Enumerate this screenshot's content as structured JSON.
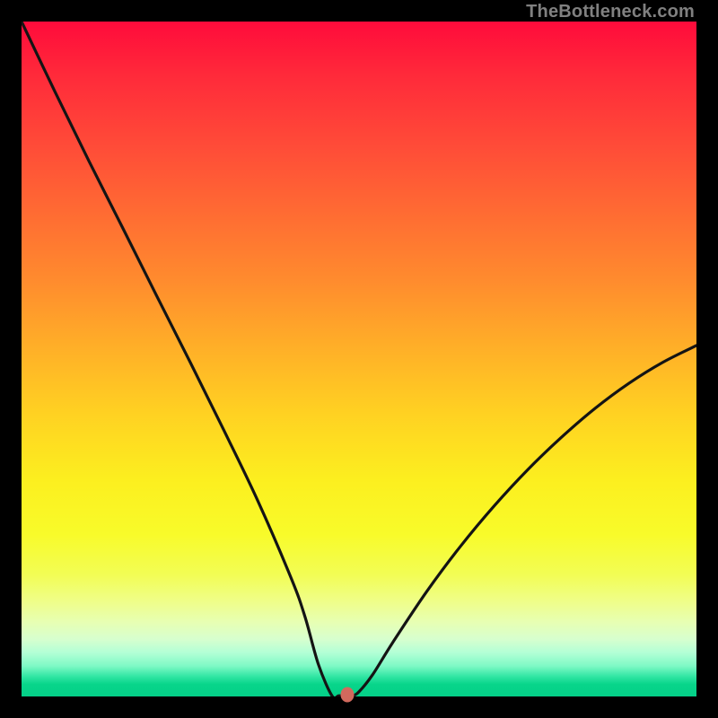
{
  "attribution": "TheBottleneck.com",
  "colors": {
    "background": "#000000",
    "curve": "#141414",
    "marker": "#d1695d"
  },
  "chart_data": {
    "type": "line",
    "title": "",
    "xlabel": "",
    "ylabel": "",
    "xlim": [
      0,
      100
    ],
    "ylim": [
      0,
      100
    ],
    "marker": {
      "x": 48.3,
      "y": 99.8
    },
    "series": [
      {
        "name": "curve",
        "x": [
          0,
          5,
          10,
          15,
          20,
          25,
          30,
          35,
          40,
          42,
          44,
          46,
          47,
          48,
          49,
          50,
          52,
          55,
          60,
          65,
          70,
          75,
          80,
          85,
          90,
          95,
          100
        ],
        "y": [
          0,
          10.5,
          20.7,
          30.6,
          40.6,
          50.5,
          60.6,
          71.0,
          82.6,
          88.2,
          95.3,
          99.9,
          99.9,
          99.9,
          99.9,
          99.3,
          96.8,
          92.0,
          84.5,
          77.8,
          71.8,
          66.4,
          61.6,
          57.3,
          53.6,
          50.5,
          48.0
        ]
      }
    ],
    "annotations": []
  }
}
